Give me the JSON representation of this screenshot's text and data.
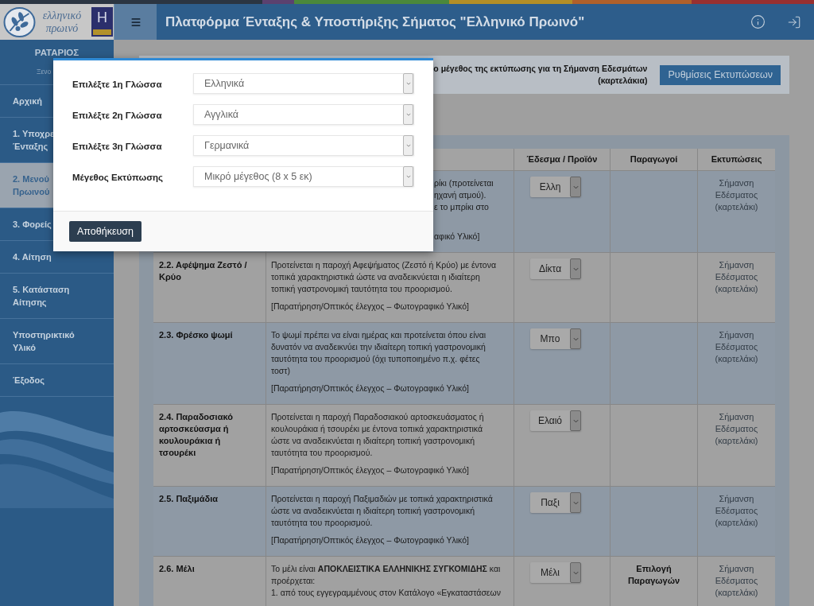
{
  "header": {
    "logo_lines": [
      "ελληνικό",
      "πρωινό"
    ],
    "badge": "H",
    "title": "Πλατφόρμα Ένταξης & Υποστήριξης Σήματος \"Ελληνικό Πρωινό\""
  },
  "sidebar": {
    "user_name": "ΡΑΤΑΡΙΟΣ",
    "user_subtitle": "Ξενο",
    "items": [
      {
        "lines": [
          "Αρχική"
        ],
        "selected": false
      },
      {
        "lines": [
          "1. Υποχρε",
          "Ένταξης"
        ],
        "selected": false
      },
      {
        "lines": [
          "2. Μενού",
          "Πρωινού"
        ],
        "selected": true
      },
      {
        "lines": [
          "3. Φορείς"
        ],
        "selected": false
      },
      {
        "lines": [
          "4. Αίτηση"
        ],
        "selected": false
      },
      {
        "lines": [
          "5. Κατάσταση",
          "Αίτησης"
        ],
        "selected": false
      },
      {
        "lines": [
          "Υποστηρικτικό",
          "Υλικό"
        ],
        "selected": false
      },
      {
        "lines": [
          "Έξοδος"
        ],
        "selected": false
      }
    ]
  },
  "info_bar": {
    "text_lines": [
      "ο μέγεθος της εκτύπωσης για τη Σήμανση Εδεσμάτων",
      "(καρτελάκια)"
    ],
    "button": "Ρυθμίσεις Εκτυπώσεων"
  },
  "table": {
    "columns": [
      "Έδεσμα / Προϊόν",
      "Παραγωγοί",
      "Εκτυπώσεις"
    ],
    "rows": [
      {
        "kind": "covered",
        "description_lines": [
          "ρίκι (προτείνεται",
          "ηχανή ατμού).",
          "ε το μπρίκι στο"
        ],
        "note": "αφικό Υλικό]",
        "product": "Ελλη",
        "print_lines": [
          "Σήμανση",
          "Εδέσματος",
          "(καρτελάκι)"
        ]
      },
      {
        "kind": "full",
        "title_lines": [
          "2.2. Αφέψημα Ζεστό /",
          "Κρύο"
        ],
        "description_lines": [
          "Προτείνεται η παροχή Αφεψήματος (Ζεστό ή Κρύο) με έντονα",
          "τοπικά χαρακτηριστικά ώστε να αναδεικνύεται η ιδιαίτερη",
          "τοπική γαστρονομική ταυτότητα του προορισμού."
        ],
        "note": "[Παρατήρηση/Οπτικός έλεγχος – Φωτογραφικό Υλικό]",
        "product": "Δίκτα",
        "print_lines": [
          "Σήμανση",
          "Εδέσματος",
          "(καρτελάκι)"
        ]
      },
      {
        "kind": "full",
        "title_lines": [
          "2.3. Φρέσκο ψωμί"
        ],
        "description_lines": [
          "Το ψωμί πρέπει να είναι ημέρας και προτείνεται όπου είναι",
          "δυνατόν να αναδεικνύει την ιδιαίτερη τοπική γαστρονομική",
          "ταυτότητα του προορισμού (όχι τυποποιημένο π.χ. φέτες",
          "τοστ)"
        ],
        "note": "[Παρατήρηση/Οπτικός έλεγχος – Φωτογραφικό Υλικό]",
        "product": "Μπο",
        "print_lines": [
          "Σήμανση",
          "Εδέσματος",
          "(καρτελάκι)"
        ]
      },
      {
        "kind": "full",
        "title_lines": [
          "2.4. Παραδοσιακό",
          "αρτοσκεύασμα ή",
          "κουλουράκια ή",
          "τσουρέκι"
        ],
        "description_lines": [
          "Προτείνεται η παροχή Παραδοσιακού αρτοσκευάσματος ή",
          "κουλουράκια ή τσουρέκι με έντονα τοπικά χαρακτηριστικά",
          "ώστε να αναδεικνύεται η ιδιαίτερη τοπική γαστρονομική",
          "ταυτότητα του προορισμού."
        ],
        "note": "[Παρατήρηση/Οπτικός έλεγχος – Φωτογραφικό Υλικό]",
        "product": "Ελαιό",
        "print_lines": [
          "Σήμανση",
          "Εδέσματος",
          "(καρτελάκι)"
        ]
      },
      {
        "kind": "full",
        "title_lines": [
          "2.5. Παξιμάδια"
        ],
        "description_lines": [
          "Προτείνεται η παροχή Παξιμαδιών με τοπικά χαρακτηριστικά",
          "ώστε να αναδεικνύεται η ιδιαίτερη τοπική γαστρονομική",
          "ταυτότητα του προορισμού."
        ],
        "note": "[Παρατήρηση/Οπτικός έλεγχος – Φωτογραφικό Υλικό]",
        "product": "Παξι",
        "print_lines": [
          "Σήμανση",
          "Εδέσματος",
          "(καρτελάκι)"
        ]
      },
      {
        "kind": "full",
        "title_lines": [
          "2.6. Μέλι"
        ],
        "description_lines": [
          "Το μέλι είναι **ΑΠΟΚΛΕΙΣΤΙΚΑ ΕΛΛΗΝΙΚΗΣ ΣΥΓΚΟΜΙΔΗΣ** και",
          "προέρχεται:",
          "1. από τους εγγεγραμμένους στον Κατάλογο «Εγκαταστάσεων"
        ],
        "product": "Μέλι",
        "producer_lines": [
          "Επιλογή",
          "Παραγωγών"
        ],
        "print_lines": [
          "Σήμανση",
          "Εδέσματος",
          "(καρτελάκι)"
        ]
      }
    ]
  },
  "modal": {
    "fields": [
      {
        "label": "Επιλέξτε 1η Γλώσσα",
        "value": "Ελληνικά"
      },
      {
        "label": "Επιλέξτε 2η Γλώσσα",
        "value": "Αγγλικά"
      },
      {
        "label": "Επιλέξτε 3η Γλώσσα",
        "value": "Γερμανικά"
      },
      {
        "label": "Μέγεθος Εκτύπωσης",
        "value": "Μικρό μέγεθος (8 x 5 εκ)"
      }
    ],
    "save_button": "Αποθήκευση"
  }
}
